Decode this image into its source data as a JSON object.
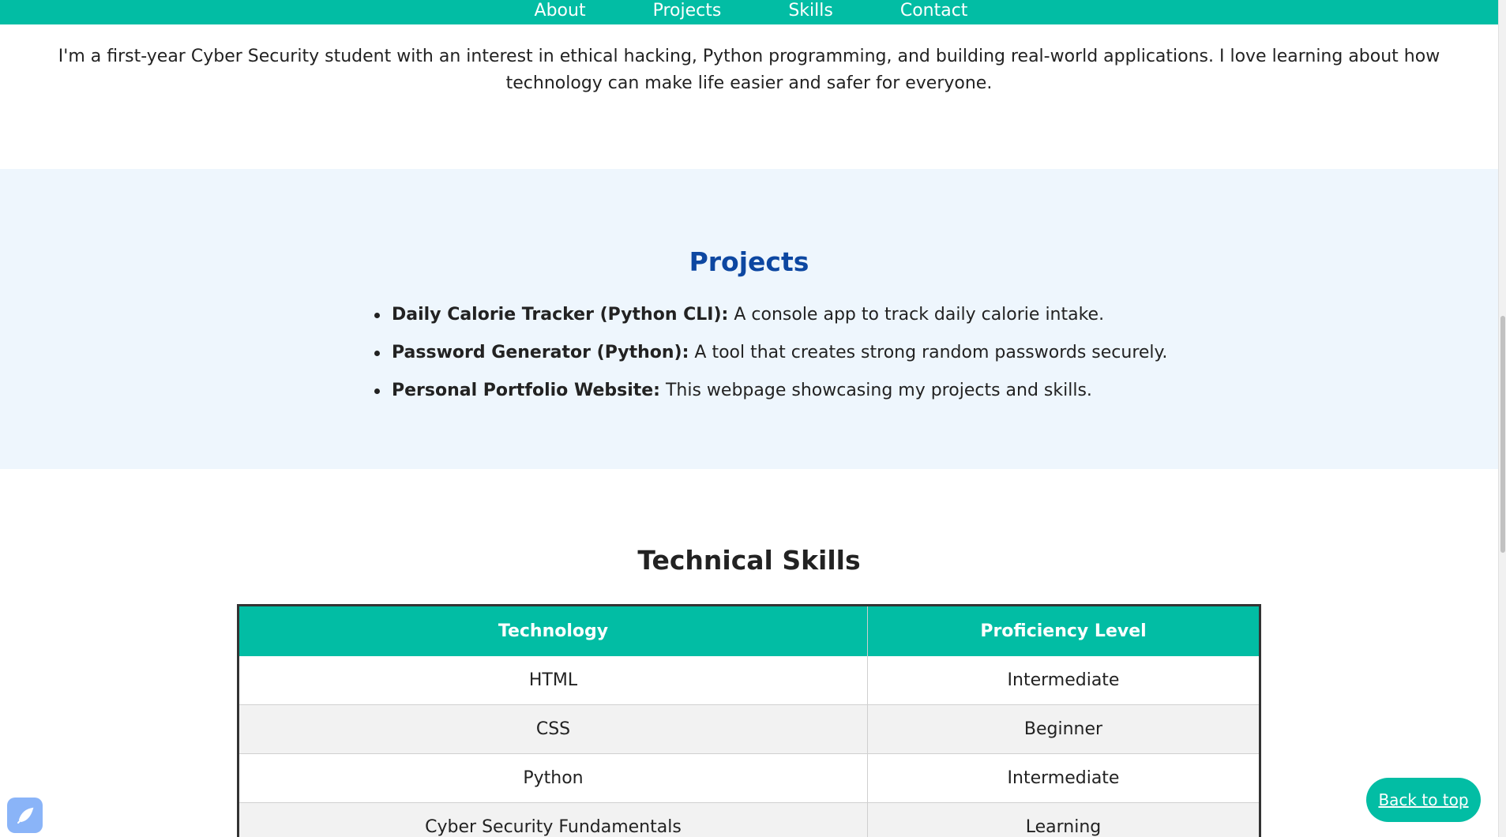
{
  "nav": {
    "items": [
      "About",
      "Projects",
      "Skills",
      "Contact"
    ]
  },
  "about": {
    "text": "I'm a first-year Cyber Security student with an interest in ethical hacking, Python programming, and building real-world applications. I love learning about how technology can make life easier and safer for everyone."
  },
  "projects": {
    "title": "Projects",
    "items": [
      {
        "name": "Daily Calorie Tracker (Python CLI):",
        "desc": " A console app to track daily calorie intake."
      },
      {
        "name": "Password Generator (Python):",
        "desc": " A tool that creates strong random passwords securely."
      },
      {
        "name": "Personal Portfolio Website:",
        "desc": " This webpage showcasing my projects and skills."
      }
    ]
  },
  "skills": {
    "title": "Technical Skills",
    "headers": [
      "Technology",
      "Proficiency Level"
    ],
    "rows": [
      [
        "HTML",
        "Intermediate"
      ],
      [
        "CSS",
        "Beginner"
      ],
      [
        "Python",
        "Intermediate"
      ],
      [
        "Cyber Security Fundamentals",
        "Learning"
      ]
    ]
  },
  "back_to_top": {
    "label": "Back to top"
  },
  "extension": {
    "icon": "extension-icon"
  },
  "colors": {
    "accent": "#02bda4",
    "projects_title": "#0d47a1",
    "projects_bg": "#eef6fd"
  }
}
